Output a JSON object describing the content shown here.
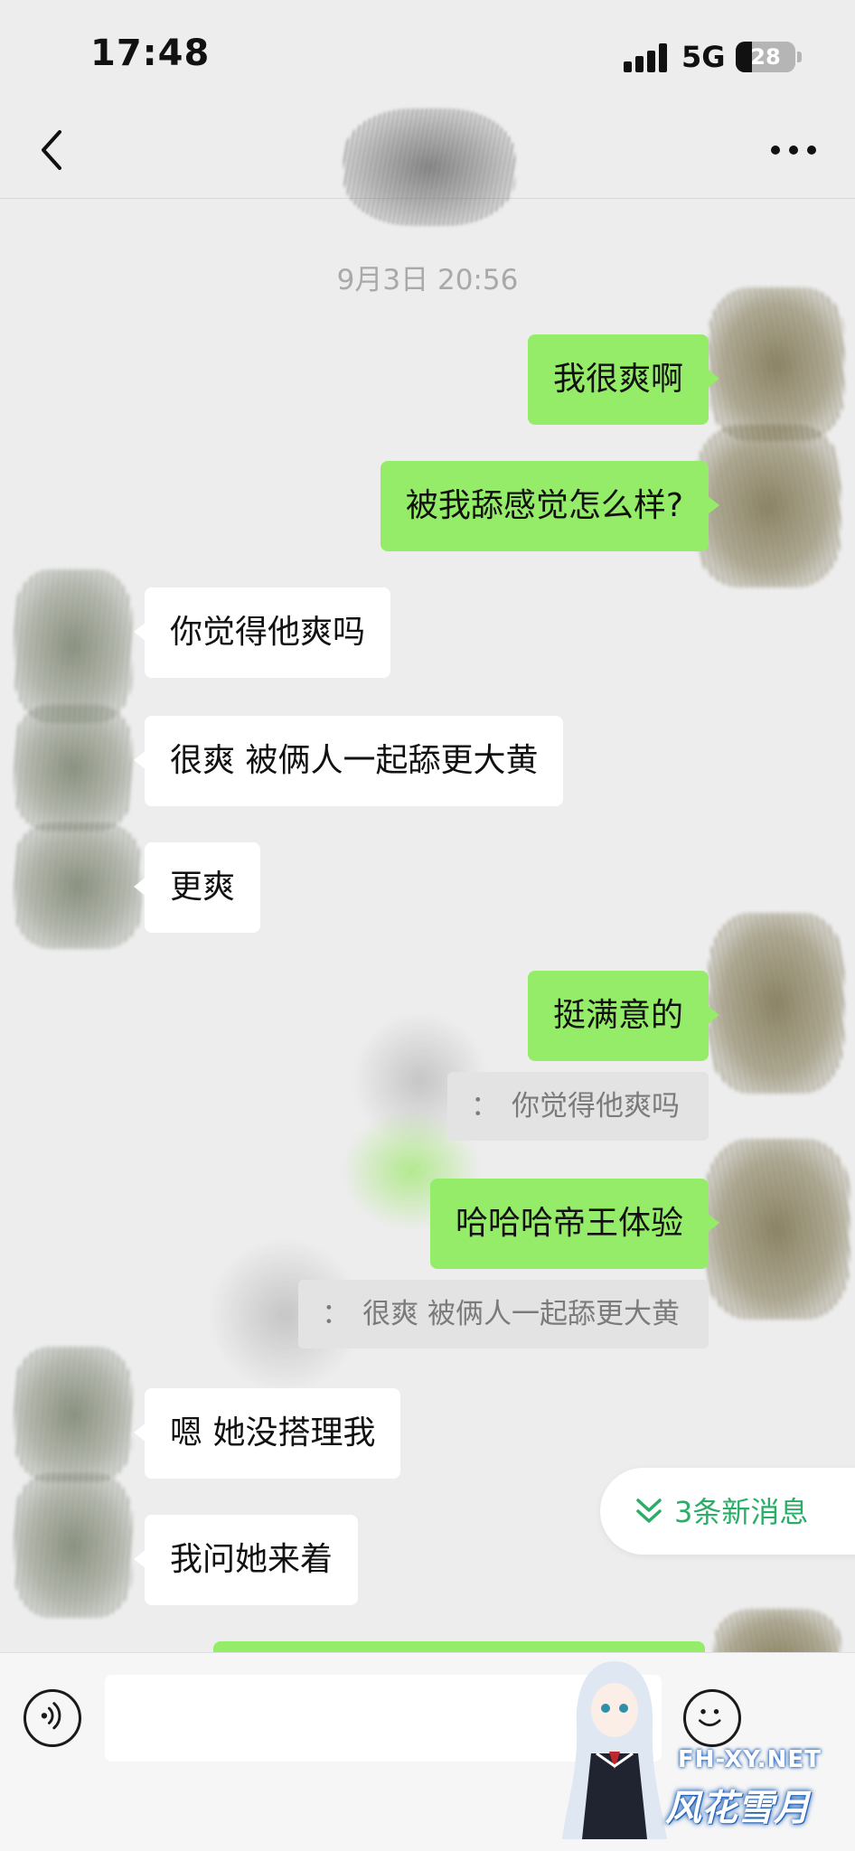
{
  "status_bar": {
    "time": "17:48",
    "network": "5G",
    "battery": "28",
    "battery_level": 0.28
  },
  "nav": {
    "back_icon": "chevron-left-icon",
    "more_icon": "more-dots-icon"
  },
  "chat": {
    "timestamp": "9月3日 20:56",
    "messages": [
      {
        "side": "out",
        "text": "我很爽啊"
      },
      {
        "side": "out",
        "text": "被我舔感觉怎么样?"
      },
      {
        "side": "in",
        "text": "你觉得他爽吗"
      },
      {
        "side": "in",
        "text": "很爽 被俩人一起舔更大黄"
      },
      {
        "side": "in",
        "text": "更爽"
      },
      {
        "side": "out",
        "text": "挺满意的"
      },
      {
        "side": "out",
        "text": "哈哈哈帝王体验"
      },
      {
        "side": "in",
        "text": "嗯 她没搭理我"
      },
      {
        "side": "in",
        "text": "我问她来着"
      }
    ],
    "quotes": [
      {
        "prefix": "：",
        "text": "你觉得他爽吗"
      },
      {
        "prefix": "：",
        "text": "很爽 被俩人一起舔更大黄"
      }
    ]
  },
  "new_messages": {
    "label": "3条新消息",
    "icon": "double-chevron-down-icon",
    "color": "#2aae67"
  },
  "input_bar": {
    "placeholder": "",
    "voice_icon": "voice-icon",
    "emoji_icon": "emoji-icon"
  },
  "watermark": {
    "site": "FH-XY.NET",
    "brand": "风花雪月"
  },
  "colors": {
    "outgoing_bubble": "#95ec69",
    "incoming_bubble": "#ffffff",
    "background": "#ededed"
  }
}
